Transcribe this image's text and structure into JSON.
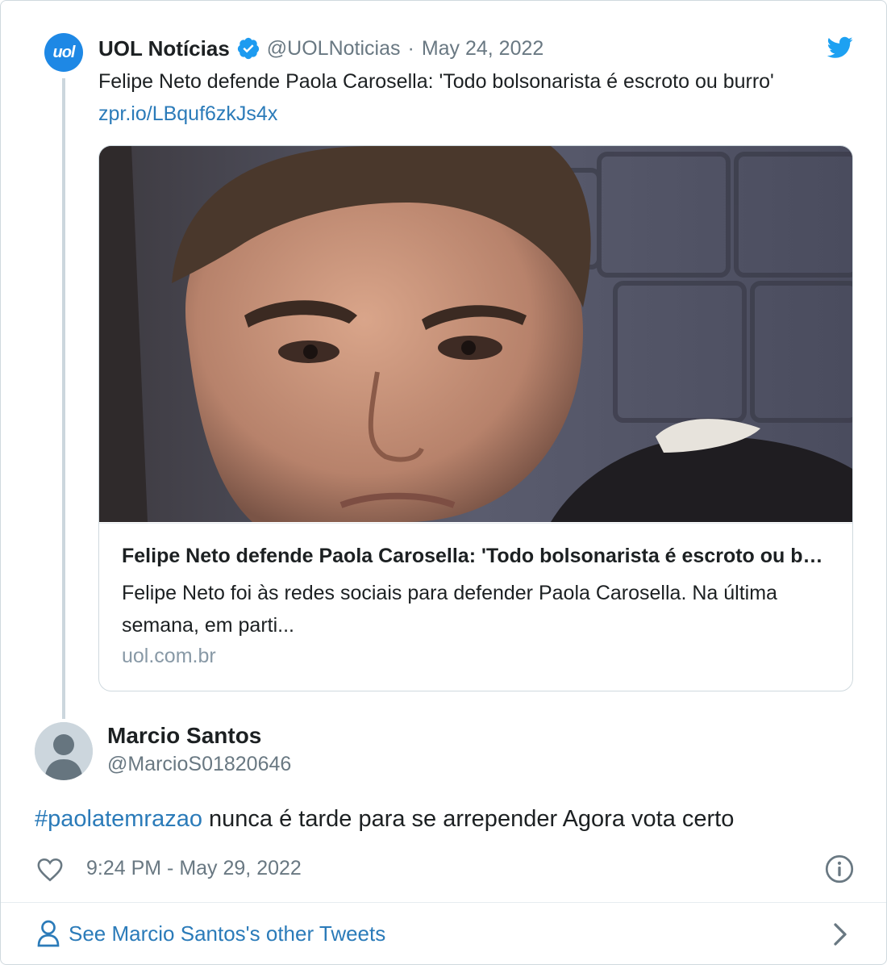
{
  "quoted_tweet": {
    "author_name": "UOL Notícias",
    "avatar_text": "uol",
    "handle": "@UOLNoticias",
    "separator": "·",
    "date": "May 24, 2022",
    "text": "Felipe Neto defende Paola Carosella: 'Todo bolsonarista é escroto ou burro' ",
    "link": "zpr.io/LBquf6zkJs4x",
    "card": {
      "title": "Felipe Neto defende Paola Carosella: 'Todo bolsonarista é escroto ou burro'",
      "description": "Felipe Neto foi às redes sociais para defender Paola Carosella. Na última semana, em parti...",
      "domain": "uol.com.br"
    }
  },
  "tweet": {
    "author_name": "Marcio Santos",
    "handle": "@MarcioS01820646",
    "hashtag": "#paolatemrazao",
    "text": " nunca é tarde para se arrepender Agora vota certo",
    "timestamp": "9:24 PM - May 29, 2022"
  },
  "footer": {
    "see_more": "See Marcio Santos's other Tweets"
  },
  "colors": {
    "link": "#2b7bb9",
    "verified": "#1d9bf0",
    "twitter_bird": "#1da1f2",
    "uol_avatar": "#1e88e5"
  },
  "icons": [
    "verified-badge-icon",
    "twitter-bird-icon",
    "heart-icon",
    "info-icon",
    "person-icon",
    "chevron-right-icon"
  ]
}
